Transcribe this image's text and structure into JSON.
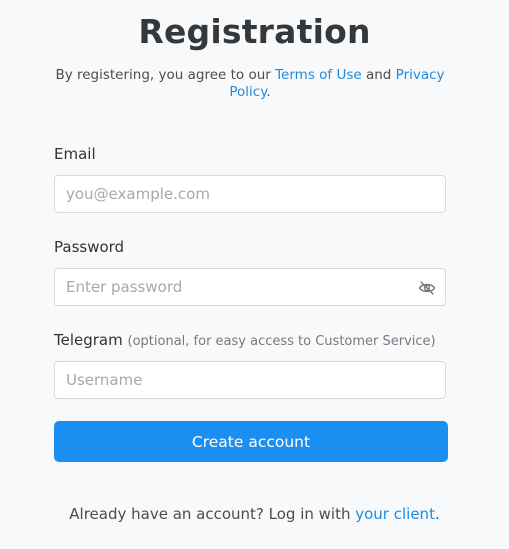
{
  "page": {
    "title": "Registration"
  },
  "agreement": {
    "prefix": "By registering, you agree to our ",
    "terms_link": "Terms of Use",
    "and": " and ",
    "privacy_link": "Privacy Policy",
    "suffix": "."
  },
  "email": {
    "label": "Email",
    "placeholder": "you@example.com",
    "value": ""
  },
  "password": {
    "label": "Password",
    "placeholder": "Enter password",
    "value": "",
    "toggle_icon": "eye-slash-icon"
  },
  "telegram": {
    "label": "Telegram",
    "hint": "(optional, for easy access to Customer Service)",
    "placeholder": "Username",
    "value": ""
  },
  "submit": {
    "label": "Create account"
  },
  "footer": {
    "prefix": "Already have an account? Log in with ",
    "link": "your client",
    "suffix": "."
  },
  "colors": {
    "background": "#f8f9fa",
    "accent": "#1b8ef2",
    "link": "#1d8ce0",
    "input_border": "#d6d9dd"
  }
}
